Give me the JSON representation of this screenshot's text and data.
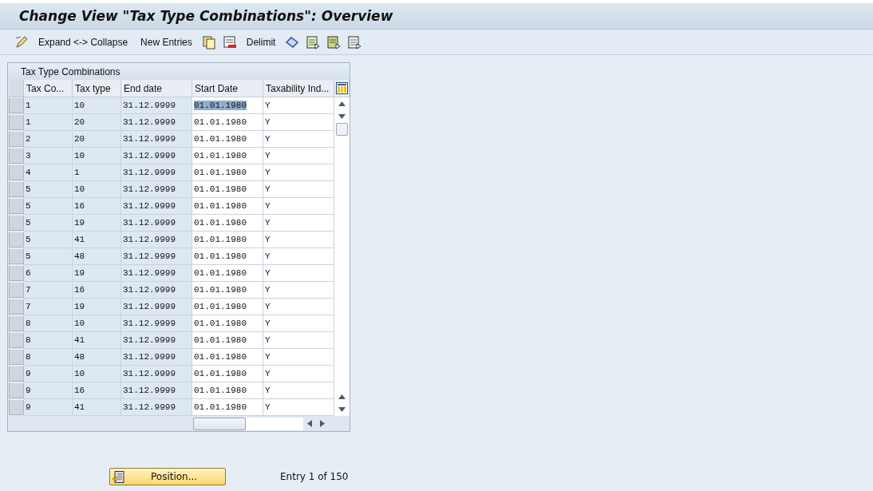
{
  "window": {
    "title": "Change View \"Tax Type Combinations\": Overview"
  },
  "toolbar": {
    "items": [
      {
        "kind": "icon"
      },
      {
        "kind": "text",
        "label": "Expand <-> Collapse"
      },
      {
        "kind": "text",
        "label": "New Entries"
      },
      {
        "kind": "icon"
      },
      {
        "kind": "icon"
      },
      {
        "kind": "text",
        "label": "Delimit"
      },
      {
        "kind": "icon"
      },
      {
        "kind": "icon"
      },
      {
        "kind": "icon"
      },
      {
        "kind": "icon"
      }
    ]
  },
  "table": {
    "title": "Tax Type Combinations",
    "columns": [
      "Tax Co...",
      "Tax type",
      "End date",
      "Start Date",
      "Taxability Ind..."
    ],
    "rows": [
      {
        "cells": [
          "1",
          "10",
          "31.12.9999",
          "01.01.1980",
          "Y"
        ],
        "selected": true
      },
      {
        "cells": [
          "1",
          "20",
          "31.12.9999",
          "01.01.1980",
          "Y"
        ],
        "selected": false
      },
      {
        "cells": [
          "2",
          "20",
          "31.12.9999",
          "01.01.1980",
          "Y"
        ],
        "selected": false
      },
      {
        "cells": [
          "3",
          "10",
          "31.12.9999",
          "01.01.1980",
          "Y"
        ],
        "selected": false
      },
      {
        "cells": [
          "4",
          "1",
          "31.12.9999",
          "01.01.1980",
          "Y"
        ],
        "selected": false
      },
      {
        "cells": [
          "5",
          "10",
          "31.12.9999",
          "01.01.1980",
          "Y"
        ],
        "selected": false
      },
      {
        "cells": [
          "5",
          "16",
          "31.12.9999",
          "01.01.1980",
          "Y"
        ],
        "selected": false
      },
      {
        "cells": [
          "5",
          "19",
          "31.12.9999",
          "01.01.1980",
          "Y"
        ],
        "selected": false
      },
      {
        "cells": [
          "5",
          "41",
          "31.12.9999",
          "01.01.1980",
          "Y"
        ],
        "selected": false
      },
      {
        "cells": [
          "5",
          "48",
          "31.12.9999",
          "01.01.1980",
          "Y"
        ],
        "selected": false
      },
      {
        "cells": [
          "6",
          "19",
          "31.12.9999",
          "01.01.1980",
          "Y"
        ],
        "selected": false
      },
      {
        "cells": [
          "7",
          "16",
          "31.12.9999",
          "01.01.1980",
          "Y"
        ],
        "selected": false
      },
      {
        "cells": [
          "7",
          "19",
          "31.12.9999",
          "01.01.1980",
          "Y"
        ],
        "selected": false
      },
      {
        "cells": [
          "8",
          "10",
          "31.12.9999",
          "01.01.1980",
          "Y"
        ],
        "selected": false
      },
      {
        "cells": [
          "8",
          "41",
          "31.12.9999",
          "01.01.1980",
          "Y"
        ],
        "selected": false
      },
      {
        "cells": [
          "8",
          "48",
          "31.12.9999",
          "01.01.1980",
          "Y"
        ],
        "selected": false
      },
      {
        "cells": [
          "9",
          "10",
          "31.12.9999",
          "01.01.1980",
          "Y"
        ],
        "selected": false
      },
      {
        "cells": [
          "9",
          "16",
          "31.12.9999",
          "01.01.1980",
          "Y"
        ],
        "selected": false
      },
      {
        "cells": [
          "9",
          "41",
          "31.12.9999",
          "01.01.1980",
          "Y"
        ],
        "selected": false
      }
    ]
  },
  "footer": {
    "button": "Position...",
    "entry": "Entry 1 of 150"
  }
}
